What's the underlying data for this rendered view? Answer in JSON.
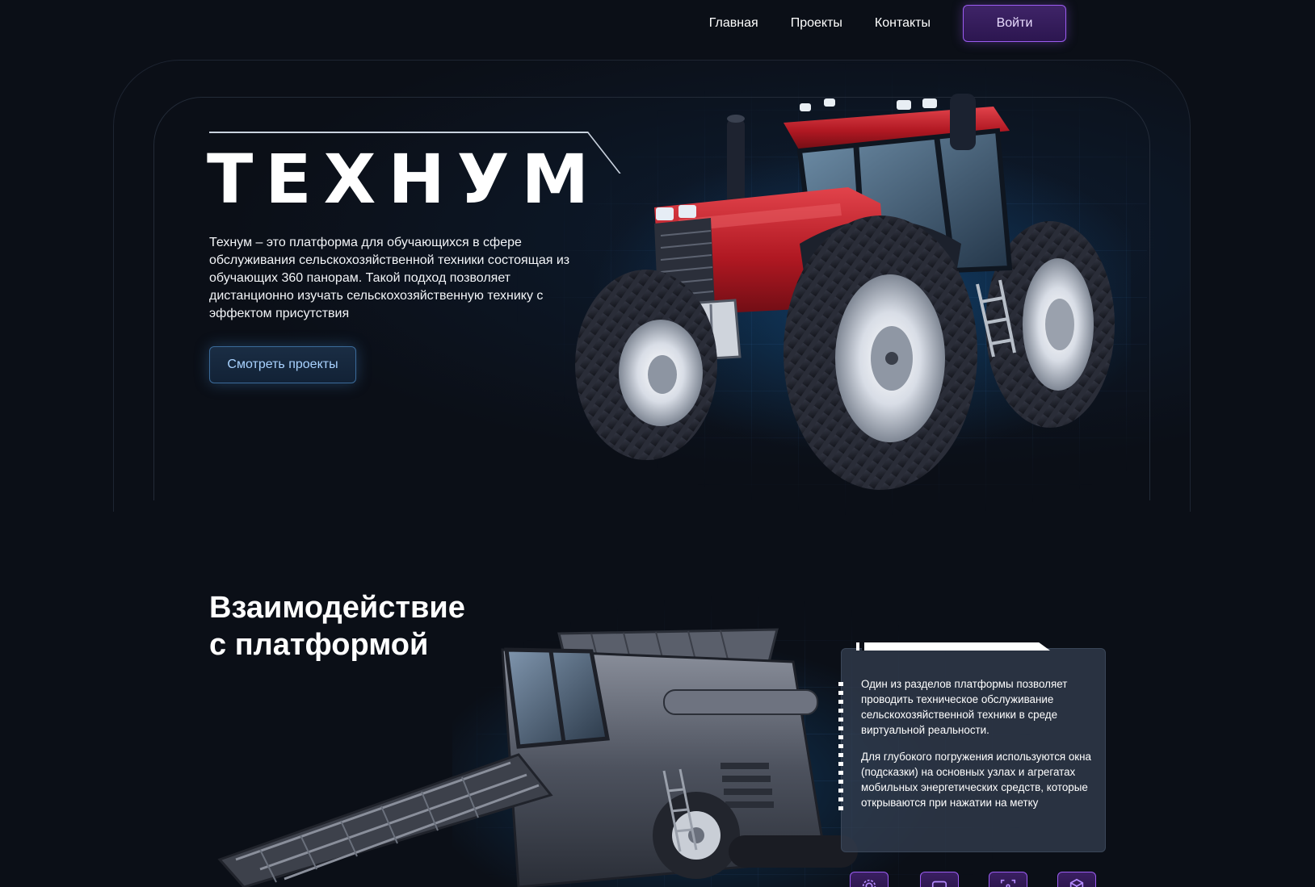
{
  "nav": {
    "links": [
      {
        "label": "Главная"
      },
      {
        "label": "Проекты"
      },
      {
        "label": "Контакты"
      }
    ],
    "login_label": "Войти"
  },
  "hero": {
    "title": "ТЕХНУМ",
    "description": "Технум – это платформа для обучающихся в сфере обслуживания сельскохозяйственной техники состоящая из обучающих 360 панорам. Такой подход позволяет дистанционно изучать сельскохозяйственную технику с эффектом присутствия",
    "button_label": "Смотреть проекты"
  },
  "interaction": {
    "title_line1": "Взаимодействие",
    "title_line2": "с платформой",
    "card": {
      "paragraph1": "Один из разделов платформы позволяет проводить техническое обслуживание сельскохозяйственной техники в среде виртуальной реальности.",
      "paragraph2": "Для глубокого погружения используются окна (подсказки) на основных узлах и агрегатах мобильных энергетических средств, которые открываются при нажатии на метку"
    },
    "icons": [
      {
        "name": "gear-icon"
      },
      {
        "name": "vr-headset-icon"
      },
      {
        "name": "panorama-frame-icon"
      },
      {
        "name": "cube-icon"
      }
    ]
  },
  "colors": {
    "background": "#0b0f17",
    "accent_purple": "#9b5cf0",
    "accent_blue": "#a9d2ff",
    "tractor_red": "#c0202a"
  }
}
